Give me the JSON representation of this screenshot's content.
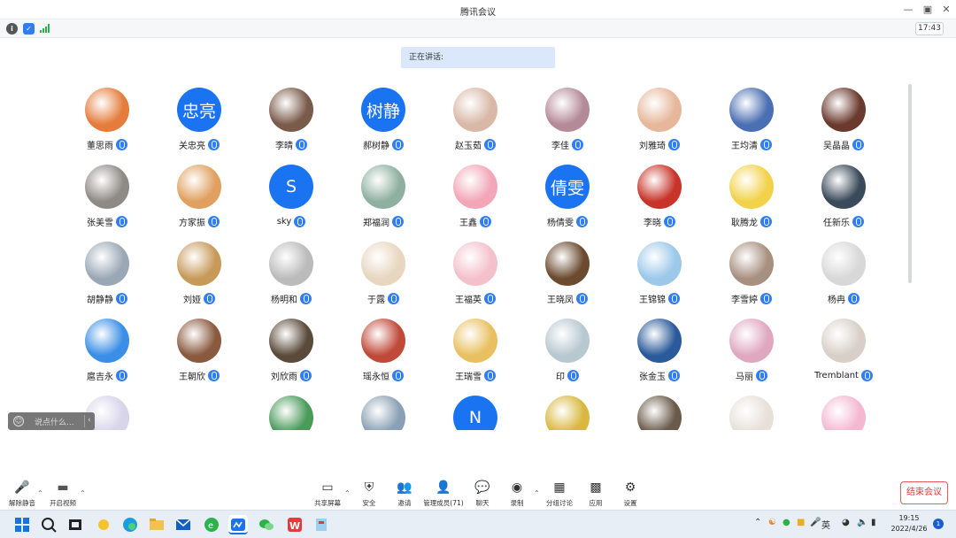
{
  "window": {
    "title": "腾讯会议",
    "clock": "17:43"
  },
  "speaking_label": "正在讲话:",
  "participants": [
    {
      "name": "董思雨",
      "avatar": "photo",
      "color": "#e57c3c"
    },
    {
      "name": "关忠亮",
      "avatar": "text",
      "text": "忠亮"
    },
    {
      "name": "李晴",
      "avatar": "photo",
      "color": "#7a5a4a"
    },
    {
      "name": "郝树静",
      "avatar": "text",
      "text": "树静"
    },
    {
      "name": "赵玉茹",
      "avatar": "photo",
      "color": "#d9b8a8"
    },
    {
      "name": "李佳",
      "avatar": "photo",
      "color": "#b48a98"
    },
    {
      "name": "刘雅琦",
      "avatar": "photo",
      "color": "#e6b79a"
    },
    {
      "name": "王均清",
      "avatar": "photo",
      "color": "#4a6fb2"
    },
    {
      "name": "吴晶晶",
      "avatar": "photo",
      "color": "#6b3a2e"
    },
    {
      "name": "张美雪",
      "avatar": "photo",
      "color": "#8e8a86"
    },
    {
      "name": "方家振",
      "avatar": "photo",
      "color": "#e0a060"
    },
    {
      "name": "sky",
      "avatar": "text",
      "text": "S"
    },
    {
      "name": "郑福润",
      "avatar": "photo",
      "color": "#8fb0a0"
    },
    {
      "name": "王鑫",
      "avatar": "photo",
      "color": "#f2a6b8"
    },
    {
      "name": "杨倩雯",
      "avatar": "text",
      "text": "倩雯"
    },
    {
      "name": "李晓",
      "avatar": "photo",
      "color": "#c8342a"
    },
    {
      "name": "耿腾龙",
      "avatar": "photo",
      "color": "#f2d24a"
    },
    {
      "name": "任新乐",
      "avatar": "photo",
      "color": "#3a4a5a"
    },
    {
      "name": "胡静静",
      "avatar": "photo",
      "color": "#9aa8b6"
    },
    {
      "name": "刘娅",
      "avatar": "photo",
      "color": "#c89a5a"
    },
    {
      "name": "杨明和",
      "avatar": "photo",
      "color": "#bbbbbb"
    },
    {
      "name": "于露",
      "avatar": "photo",
      "color": "#e8d6c0"
    },
    {
      "name": "王福英",
      "avatar": "photo",
      "color": "#f4c0cc"
    },
    {
      "name": "王晓凤",
      "avatar": "photo",
      "color": "#6b4a30"
    },
    {
      "name": "王锦锦",
      "avatar": "photo",
      "color": "#9cc8ea"
    },
    {
      "name": "李雪婷",
      "avatar": "photo",
      "color": "#a89080"
    },
    {
      "name": "杨冉",
      "avatar": "photo",
      "color": "#d8d8d8"
    },
    {
      "name": "扈吉永",
      "avatar": "photo",
      "color": "#3a8ee6"
    },
    {
      "name": "王朝欣",
      "avatar": "photo",
      "color": "#8a5a40"
    },
    {
      "name": "刘欣雨",
      "avatar": "photo",
      "color": "#5a4a3a"
    },
    {
      "name": "瑶永恒",
      "avatar": "photo",
      "color": "#c04a3a"
    },
    {
      "name": "王瑞雪",
      "avatar": "photo",
      "color": "#e8c060"
    },
    {
      "name": "印",
      "avatar": "photo",
      "color": "#b8c8d0"
    },
    {
      "name": "张金玉",
      "avatar": "photo",
      "color": "#2a5a9a"
    },
    {
      "name": "马丽",
      "avatar": "photo",
      "color": "#e0a8c0"
    },
    {
      "name": "Tremblant",
      "avatar": "photo",
      "color": "#d8d0c8"
    },
    {
      "name": "",
      "avatar": "photo",
      "color": "#d8d4ea"
    },
    {
      "name": "",
      "avatar": "photo",
      "color": "#ffffff"
    },
    {
      "name": "",
      "avatar": "photo",
      "color": "#4a9a5a"
    },
    {
      "name": "",
      "avatar": "photo",
      "color": "#8aa0b4"
    },
    {
      "name": "",
      "avatar": "text",
      "text": "N"
    },
    {
      "name": "",
      "avatar": "photo",
      "color": "#d8b840"
    },
    {
      "name": "",
      "avatar": "photo",
      "color": "#6a5a4a"
    },
    {
      "name": "",
      "avatar": "photo",
      "color": "#e8e0d8"
    },
    {
      "name": "",
      "avatar": "photo",
      "color": "#f4b8d0"
    }
  ],
  "chat": {
    "placeholder": "说点什么..."
  },
  "toolbar": [
    {
      "id": "unmute",
      "label": "解除静音",
      "icon": "mic-off-icon"
    },
    {
      "id": "video",
      "label": "开启视频",
      "icon": "video-off-icon"
    },
    {
      "id": "share",
      "label": "共享屏幕",
      "icon": "share-screen-icon"
    },
    {
      "id": "security",
      "label": "安全",
      "icon": "shield-icon"
    },
    {
      "id": "invite",
      "label": "邀请",
      "icon": "add-user-icon"
    },
    {
      "id": "members",
      "label": "管理成员(71)",
      "icon": "members-icon"
    },
    {
      "id": "chat",
      "label": "聊天",
      "icon": "chat-icon"
    },
    {
      "id": "record",
      "label": "录制",
      "icon": "record-icon"
    },
    {
      "id": "breakout",
      "label": "分组讨论",
      "icon": "breakout-icon"
    },
    {
      "id": "apps",
      "label": "应用",
      "icon": "apps-icon"
    },
    {
      "id": "settings",
      "label": "设置",
      "icon": "gear-icon"
    }
  ],
  "end_meeting": "结束会议",
  "taskbar": {
    "ime": "英",
    "time": "19:15",
    "date": "2022/4/26",
    "notifications": "1"
  },
  "colors": {
    "accent": "#1a73f0",
    "mic_badge": "#2f7ef5",
    "end": "#e23b3b"
  }
}
